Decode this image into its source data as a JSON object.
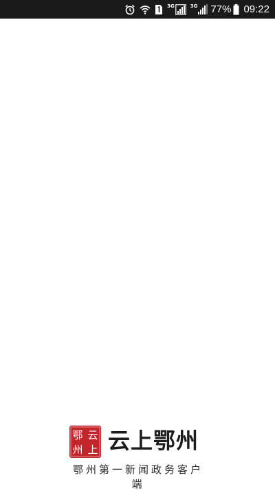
{
  "status_bar": {
    "network_label_1": "3G",
    "network_label_2": "3G",
    "battery_percent": "77%",
    "time": "09:22",
    "background": "#1a1a1a"
  },
  "splash": {
    "background": "#ffffff",
    "logo": {
      "seal_text": "鄂州云上",
      "seal_color": "#c2252c",
      "name": "云上鄂州"
    },
    "tagline": "鄂州第一新闻政务客户端"
  }
}
